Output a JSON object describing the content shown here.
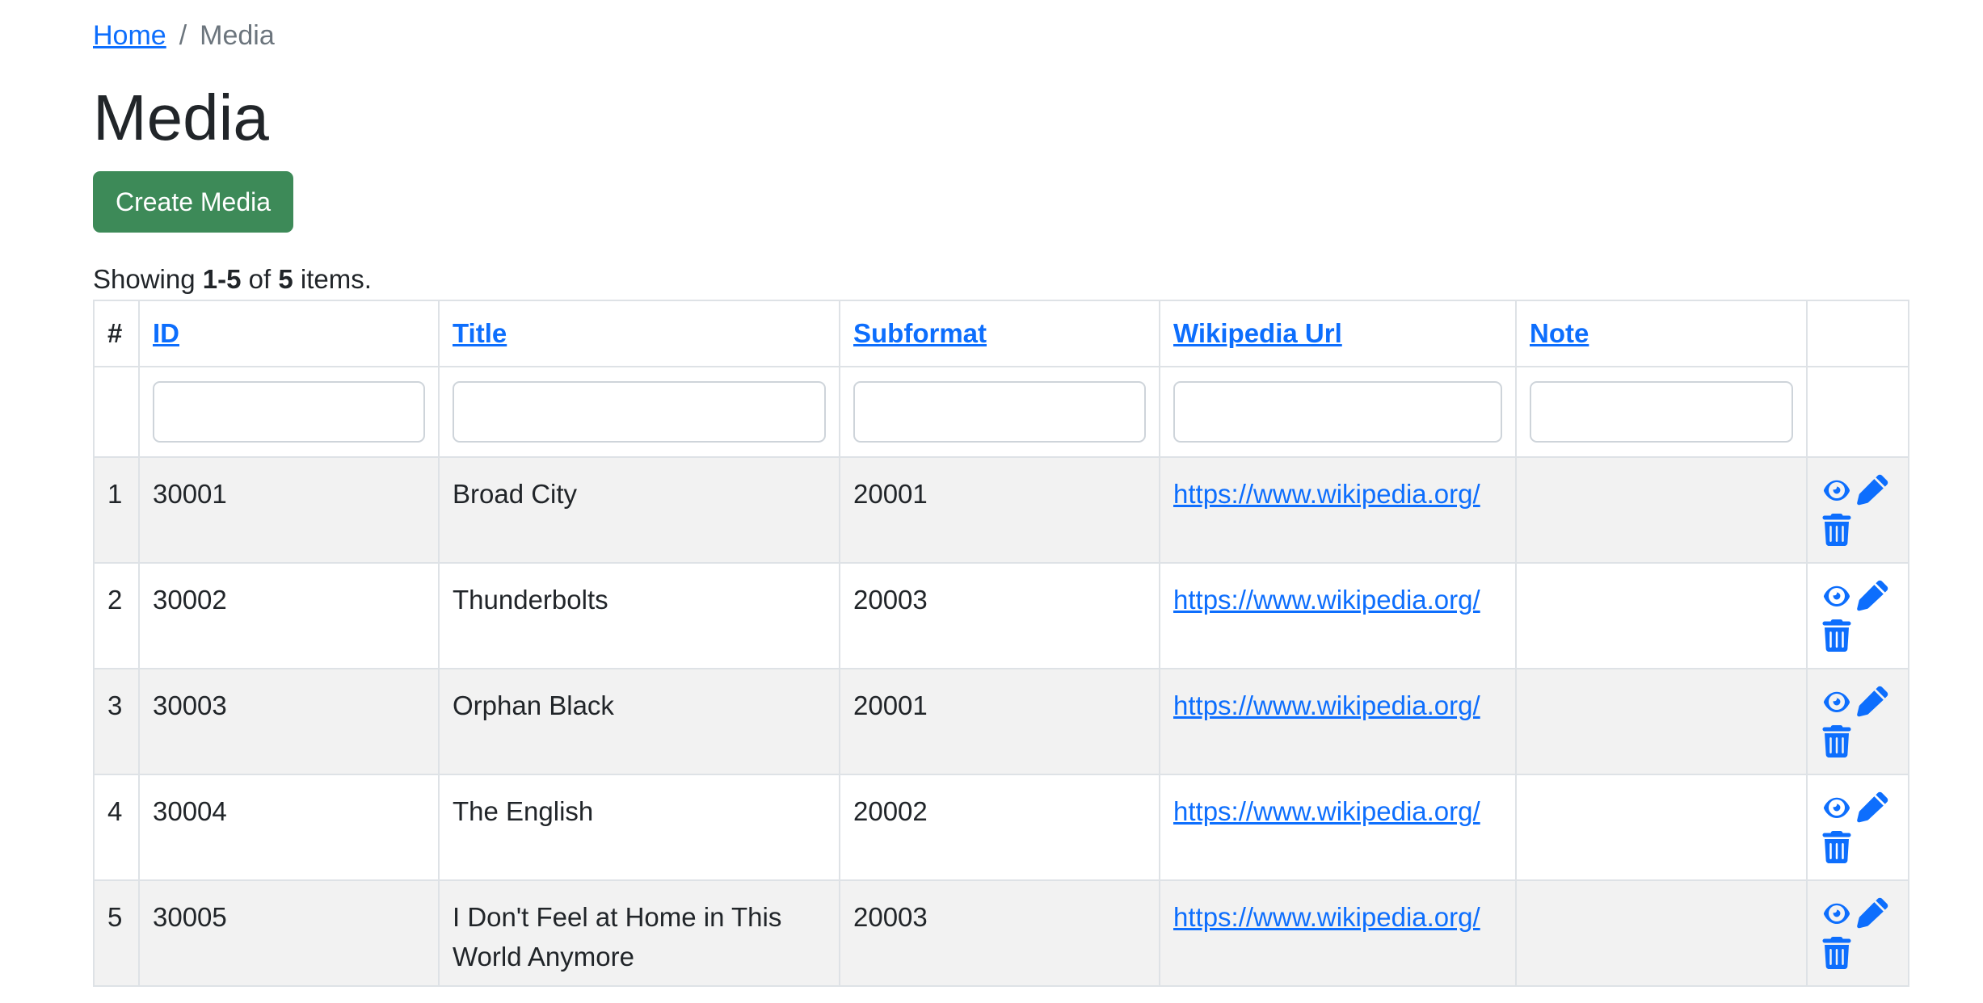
{
  "breadcrumb": {
    "home": "Home",
    "separator": "/",
    "current": "Media"
  },
  "page": {
    "title": "Media",
    "create_button": "Create Media"
  },
  "summary": {
    "prefix": "Showing ",
    "range": "1-5",
    "middle": " of ",
    "total": "5",
    "suffix": " items."
  },
  "table": {
    "headers": {
      "index": "#",
      "id": "ID",
      "title": "Title",
      "subformat": "Subformat",
      "wikipedia_url": "Wikipedia Url",
      "note": "Note"
    },
    "rows": [
      {
        "n": "1",
        "id": "30001",
        "title": "Broad City",
        "subformat": "20001",
        "url": "https://www.wikipedia.org/",
        "note": ""
      },
      {
        "n": "2",
        "id": "30002",
        "title": "Thunderbolts",
        "subformat": "20003",
        "url": "https://www.wikipedia.org/",
        "note": ""
      },
      {
        "n": "3",
        "id": "30003",
        "title": "Orphan Black",
        "subformat": "20001",
        "url": "https://www.wikipedia.org/",
        "note": ""
      },
      {
        "n": "4",
        "id": "30004",
        "title": "The English",
        "subformat": "20002",
        "url": "https://www.wikipedia.org/",
        "note": ""
      },
      {
        "n": "5",
        "id": "30005",
        "title": "I Don't Feel at Home in This World Anymore",
        "subformat": "20003",
        "url": "https://www.wikipedia.org/",
        "note": ""
      }
    ]
  },
  "icons": {
    "view": "eye-icon",
    "update": "pencil-icon",
    "delete": "trash-icon"
  },
  "colors": {
    "link": "#0d6efd",
    "create_button": "#3d8a58",
    "striped_row": "#f2f2f2",
    "border": "#dee2e6"
  }
}
